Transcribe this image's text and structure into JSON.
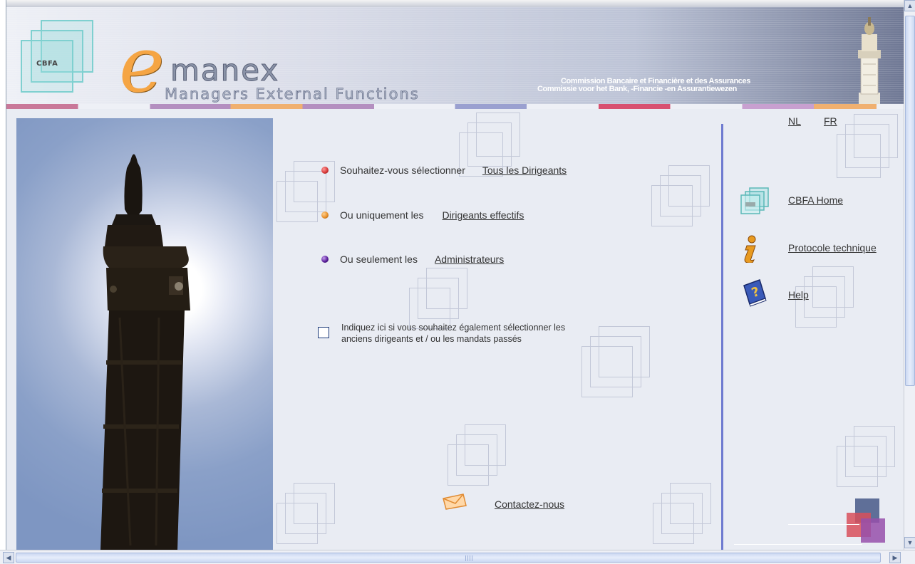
{
  "header": {
    "logo_text": "CBFA",
    "brand_e": "e",
    "brand_rest": "manex",
    "brand_sub": "Managers External Functions",
    "institution_fr": "Commission Bancaire et Financière et des Assurances",
    "institution_nl": "Commissie voor het  Bank,  -Financie  -en  Assurantiewezen"
  },
  "main": {
    "options": [
      {
        "label": "Souhaitez-vous sélectionner",
        "link": "Tous les Dirigeants",
        "bullet_color": "#d83a3a"
      },
      {
        "label": "Ou uniquement les",
        "link": "Dirigeants effectifs",
        "bullet_color": "#e8902a"
      },
      {
        "label": "Ou seulement les",
        "link": "Administrateurs",
        "bullet_color": "#5a1f9a"
      }
    ],
    "checkbox_text": "Indiquez ici si vous souhaitez également sélectionner les anciens dirigeants et / ou les mandats passés",
    "checkbox_checked": false,
    "contact_label": "Contactez-nous"
  },
  "sidebar": {
    "lang_nl": "NL",
    "lang_fr": "FR",
    "links": [
      {
        "label": "CBFA Home",
        "icon": "cbfa-logo-icon"
      },
      {
        "label": "Protocole technique",
        "icon": "info-icon"
      },
      {
        "label": "Help",
        "icon": "help-book-icon"
      }
    ]
  },
  "scrollbars": {
    "up": "▲",
    "down": "▼",
    "left": "◀",
    "right": "▶"
  },
  "colors": {
    "accent_line": "#6f7bd0",
    "background": "#e9ecf3",
    "brand_orange": "#f5a544"
  }
}
